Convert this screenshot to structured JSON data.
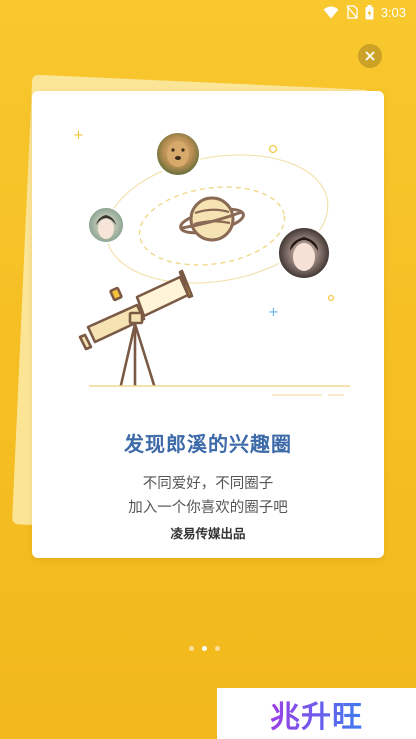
{
  "status_bar": {
    "time": "3:03"
  },
  "card": {
    "title": "发现郎溪的兴趣圈",
    "subtitle_line1": "不同爱好，不同圈子",
    "subtitle_line2": "加入一个你喜欢的圈子吧",
    "credit": "凌易传媒出品"
  },
  "pager": {
    "count": 3,
    "active_index": 1
  },
  "watermark": {
    "text": "兆升旺"
  },
  "colors": {
    "background": "#F5BE22",
    "title": "#3D6AA8",
    "card": "#FFFFFF"
  }
}
